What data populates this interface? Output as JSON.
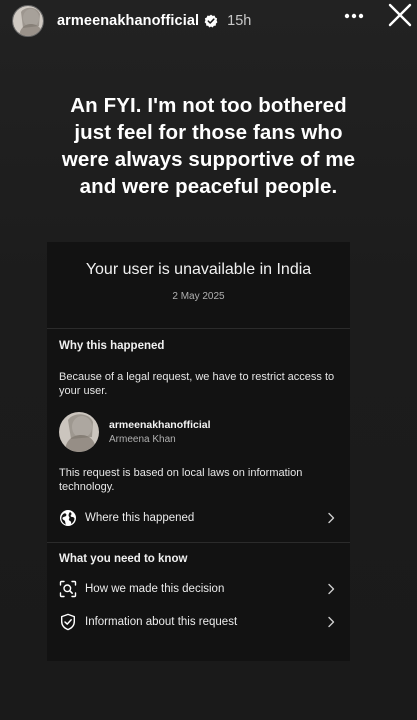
{
  "story": {
    "username": "armeenakhanofficial",
    "verified": true,
    "timestamp": "15h",
    "caption_lines": [
      "An FYI. I'm not too bothered",
      "just feel for those fans who",
      "were always supportive of me",
      "and were peaceful people."
    ]
  },
  "card": {
    "title": "Your user is unavailable in India",
    "date": "2 May 2025",
    "why": {
      "heading": "Why this happened",
      "text": "Because of a legal request, we have to restrict access to your user.",
      "profile_username": "armeenakhanofficial",
      "profile_name": "Armeena Khan",
      "law_text": "This request is based on local laws on information technology.",
      "where_label": "Where this happened"
    },
    "know": {
      "heading": "What you need to know",
      "items": [
        {
          "label": "How we made this decision",
          "icon": "magnifier-scan-icon"
        },
        {
          "label": "Information about this request",
          "icon": "shield-check-icon"
        }
      ]
    }
  },
  "colors": {
    "background": "#1b1b1b",
    "card": "#121212",
    "verified_badge": "#3897f0"
  }
}
